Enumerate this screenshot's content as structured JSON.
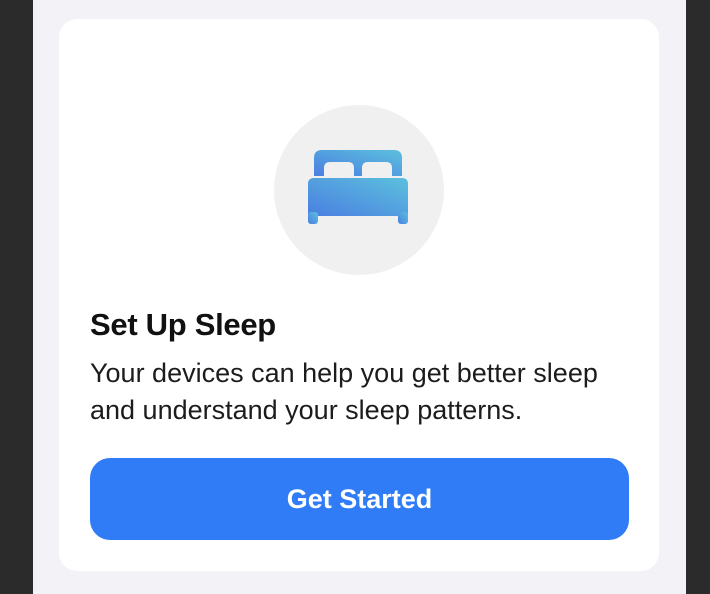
{
  "card": {
    "icon": "bed-icon",
    "title": "Set Up Sleep",
    "description": "Your devices can help you get better sleep and understand your sleep patterns.",
    "button_label": "Get Started"
  },
  "colors": {
    "accent": "#2f7cf6",
    "icon_gradient_start": "#4a7fe0",
    "icon_gradient_end": "#5cc0de",
    "background": "#f2f2f7",
    "card": "#ffffff"
  }
}
